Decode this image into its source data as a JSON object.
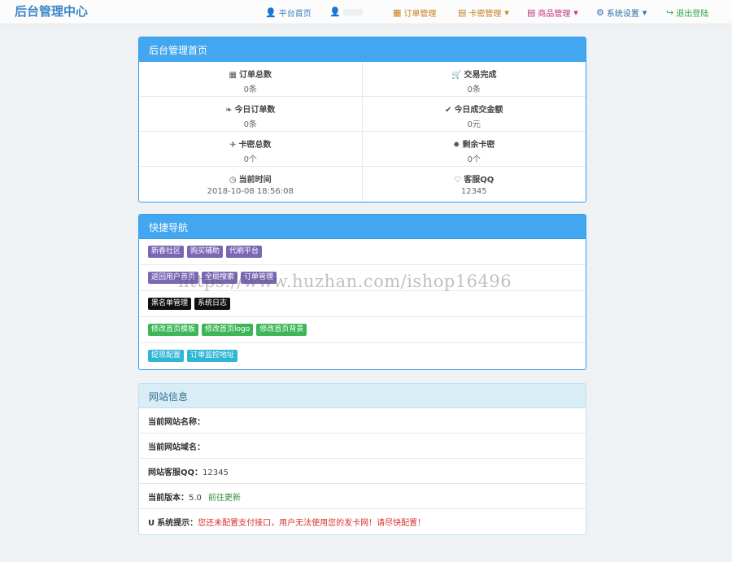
{
  "brand": "后台管理中心",
  "nav": {
    "home": {
      "icon": "user-icon",
      "label": "平台首页",
      "color": "#3a7fc1"
    },
    "user": {
      "icon": "user-icon",
      "color": "#3a7fc1"
    },
    "orders": {
      "icon": "table-icon",
      "label": "订单管理",
      "color": "#c8801a"
    },
    "cards": {
      "icon": "card-icon",
      "label": "卡密管理",
      "color": "#c8801a"
    },
    "products": {
      "icon": "box-icon",
      "label": "商品管理",
      "color": "#c0397e"
    },
    "settings": {
      "icon": "gear-icon",
      "label": "系统设置",
      "color": "#2d6fb0"
    },
    "logout": {
      "icon": "logout-icon",
      "label": "退出登陆",
      "color": "#2ea84a"
    }
  },
  "dashboard": {
    "title": "后台管理首页",
    "stats": [
      {
        "icon": "grid-icon",
        "label": "订单总数",
        "value": "0条"
      },
      {
        "icon": "cart-icon",
        "label": "交易完成",
        "value": "0条"
      },
      {
        "icon": "leaf-icon",
        "label": "今日订单数",
        "value": "0条"
      },
      {
        "icon": "check-icon",
        "label": "今日成交金额",
        "value": "0元"
      },
      {
        "icon": "plane-icon",
        "label": "卡密总数",
        "value": "0个"
      },
      {
        "icon": "asterisk-icon",
        "label": "剩余卡密",
        "value": "0个"
      },
      {
        "icon": "clock-icon",
        "label": "当前时间",
        "value": "2018-10-08 18:56:08"
      },
      {
        "icon": "heart-icon",
        "label": "客服QQ",
        "value": "12345"
      }
    ]
  },
  "quicknav": {
    "title": "快捷导航",
    "rows": [
      [
        "新春社区",
        "购买辅助",
        "代刷平台"
      ],
      [
        "返回用户首页",
        "全局搜索",
        "订单管理"
      ],
      [
        "黑名单管理",
        "系统日志"
      ],
      [
        "修改首页模板",
        "修改首页logo",
        "修改首页背景"
      ],
      [
        "提现配置",
        "订单监控地址"
      ]
    ],
    "colors": {
      "purple": "#7b68b5",
      "dark": "#111111",
      "green": "#3cb658",
      "cyan": "#2fb5d6"
    }
  },
  "siteinfo": {
    "title": "网站信息",
    "name_label": "当前网站名称：",
    "domain_label": "当前网站域名：",
    "qq_label": "网站客服QQ：",
    "qq_value": "12345",
    "version_label": "当前版本：",
    "version_value": "5.0",
    "update_link": "前往更新",
    "notice_label": "系统提示：",
    "notice_text": "您还未配置支付接口，用户无法使用您的发卡网！请尽快配置！"
  },
  "watermark": "https://www.huzhan.com/ishop16496"
}
